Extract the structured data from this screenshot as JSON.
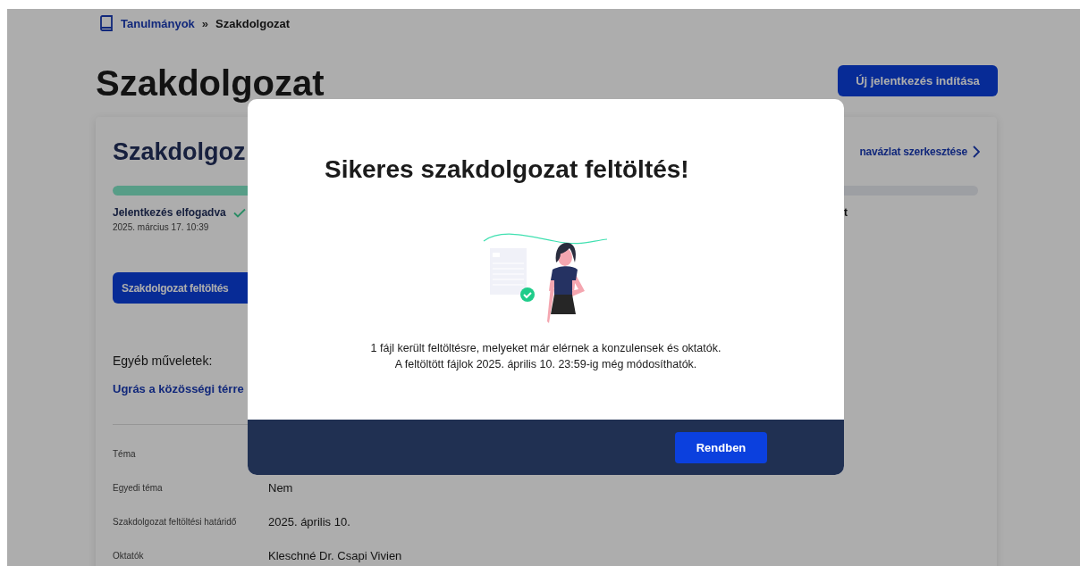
{
  "breadcrumb": {
    "items": [
      {
        "label": "Tanulmányok",
        "kind": "link"
      },
      {
        "label": "Szakdolgozat",
        "kind": "current"
      }
    ],
    "separator": "»"
  },
  "page_title": "Szakdolgozat",
  "new_application_button": "Új jelentkezés indítása",
  "card": {
    "title": "Szakdolgoz",
    "edit_link": "navázlat szerkesztése",
    "progress": {
      "level": 0.33
    },
    "steps": [
      {
        "label": "Jelentkezés elfogadva",
        "date": "2025. március 17. 10:39",
        "done": true
      }
    ],
    "step_fragment": "t",
    "upload_button": "Szakdolgozat feltöltés",
    "other_actions": {
      "label": "Egyéb műveletek:",
      "link": "Ugrás a közösségi térre"
    },
    "details": [
      {
        "label": "Téma"
      },
      {
        "label": "Egyedi téma",
        "value": "Nem"
      },
      {
        "label": "Szakdolgozat feltöltési határidő",
        "value": "2025. április 10."
      },
      {
        "label": "Oktatók",
        "value": "Kleschné Dr. Csapi Vivien"
      }
    ]
  },
  "modal": {
    "title": "Sikeres szakdolgozat feltöltés!",
    "message": [
      "1 fájl került feltöltésre, melyeket már elérnek a konzulensek és oktatók.",
      "A feltöltött fájlok 2025. április 10. 23:59-ig még módosíthatók."
    ],
    "button": "Rendben"
  }
}
